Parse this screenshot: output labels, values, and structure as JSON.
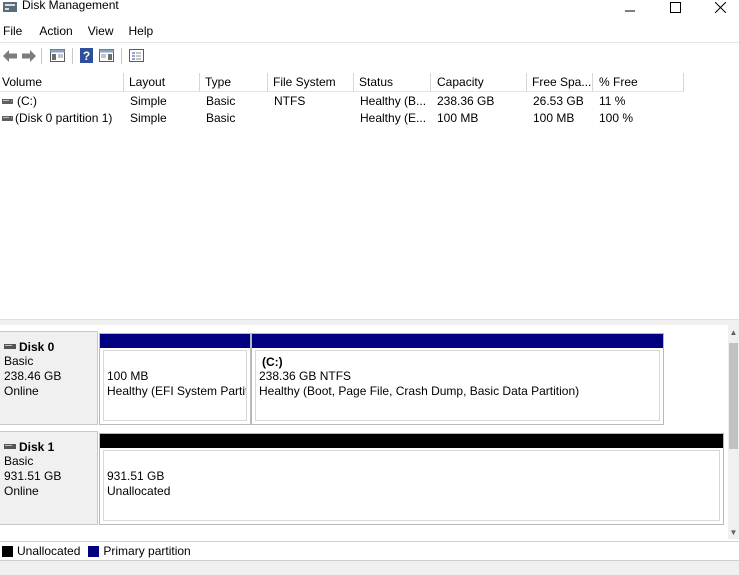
{
  "window": {
    "title": "Disk Management",
    "icon": "disk-management-icon"
  },
  "menu": [
    "File",
    "Action",
    "View",
    "Help"
  ],
  "toolbar": {
    "buttons": [
      "back-arrow-icon",
      "forward-arrow-icon",
      "show-hide-console-tree-icon",
      "help-icon",
      "properties-icon",
      "disk-list-icon"
    ]
  },
  "volumes": {
    "columns": [
      "Volume",
      "Layout",
      "Type",
      "File System",
      "Status",
      "Capacity",
      "Free Spa...",
      "% Free"
    ],
    "rows": [
      {
        "volume": "(C:)",
        "layout": "Simple",
        "type": "Basic",
        "fs": "NTFS",
        "status": "Healthy (B...",
        "capacity": "238.36 GB",
        "free": "26.53 GB",
        "pct": "11 %"
      },
      {
        "volume": "(Disk 0 partition 1)",
        "layout": "Simple",
        "type": "Basic",
        "fs": "",
        "status": "Healthy (E...",
        "capacity": "100 MB",
        "free": "100 MB",
        "pct": "100 %"
      }
    ]
  },
  "disks": [
    {
      "name": "Disk 0",
      "type": "Basic",
      "size": "238.46 GB",
      "state": "Online",
      "partitions": [
        {
          "title": "",
          "size": "100 MB",
          "status": "Healthy (EFI System Partit",
          "kind": "primary"
        },
        {
          "title": "(C:)",
          "size": "238.36 GB NTFS",
          "status": "Healthy (Boot, Page File, Crash Dump, Basic Data Partition)",
          "kind": "primary"
        }
      ]
    },
    {
      "name": "Disk 1",
      "type": "Basic",
      "size": "931.51 GB",
      "state": "Online",
      "partitions": [
        {
          "title": "",
          "size": "931.51 GB",
          "status": "Unallocated",
          "kind": "unallocated"
        }
      ]
    }
  ],
  "legend": [
    {
      "label": "Unallocated",
      "color": "#000000"
    },
    {
      "label": "Primary partition",
      "color": "#000080"
    }
  ],
  "colors": {
    "primary": "#000080",
    "unallocated": "#000000"
  }
}
